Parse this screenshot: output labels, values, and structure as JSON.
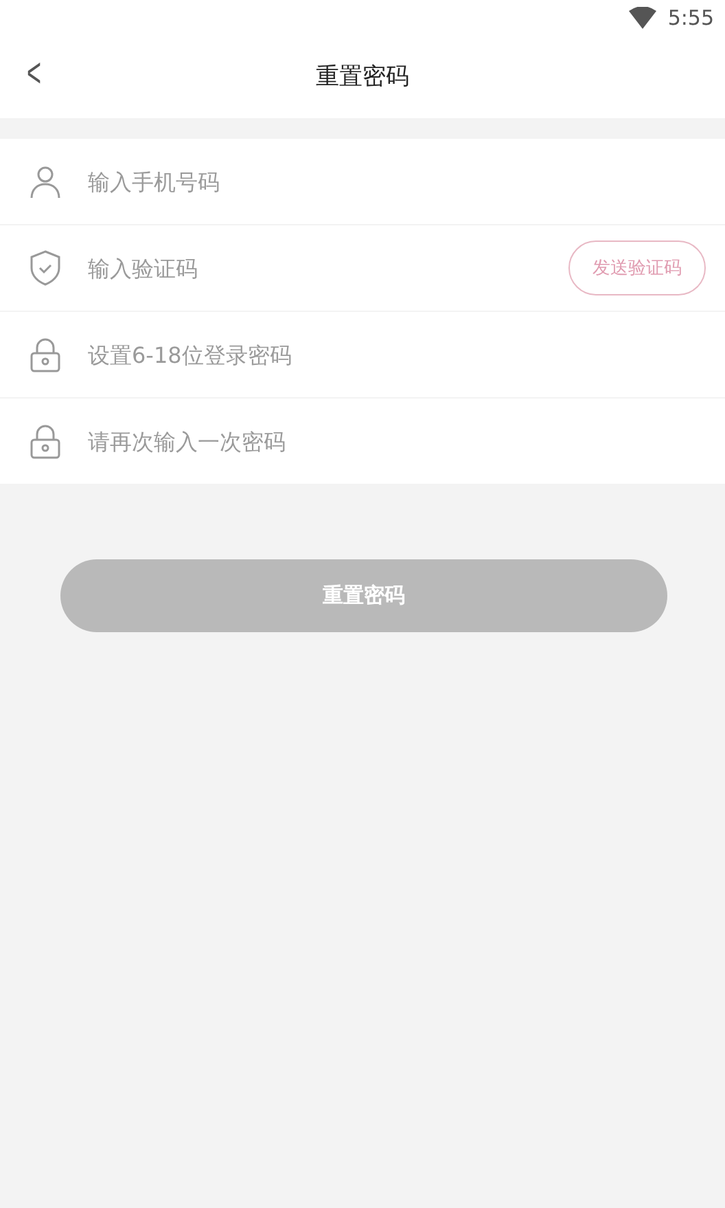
{
  "status_bar": {
    "time": "5:55"
  },
  "header": {
    "back": "<",
    "title": "重置密码"
  },
  "fields": [
    {
      "kind": "phone",
      "placeholder": "输入手机号码"
    },
    {
      "kind": "code",
      "placeholder": "输入验证码",
      "action": "发送验证码"
    },
    {
      "kind": "password",
      "placeholder": "设置6-18位登录密码"
    },
    {
      "kind": "password",
      "placeholder": "请再次输入一次密码"
    }
  ],
  "submit": {
    "label": "重置密码",
    "disabled": true
  }
}
